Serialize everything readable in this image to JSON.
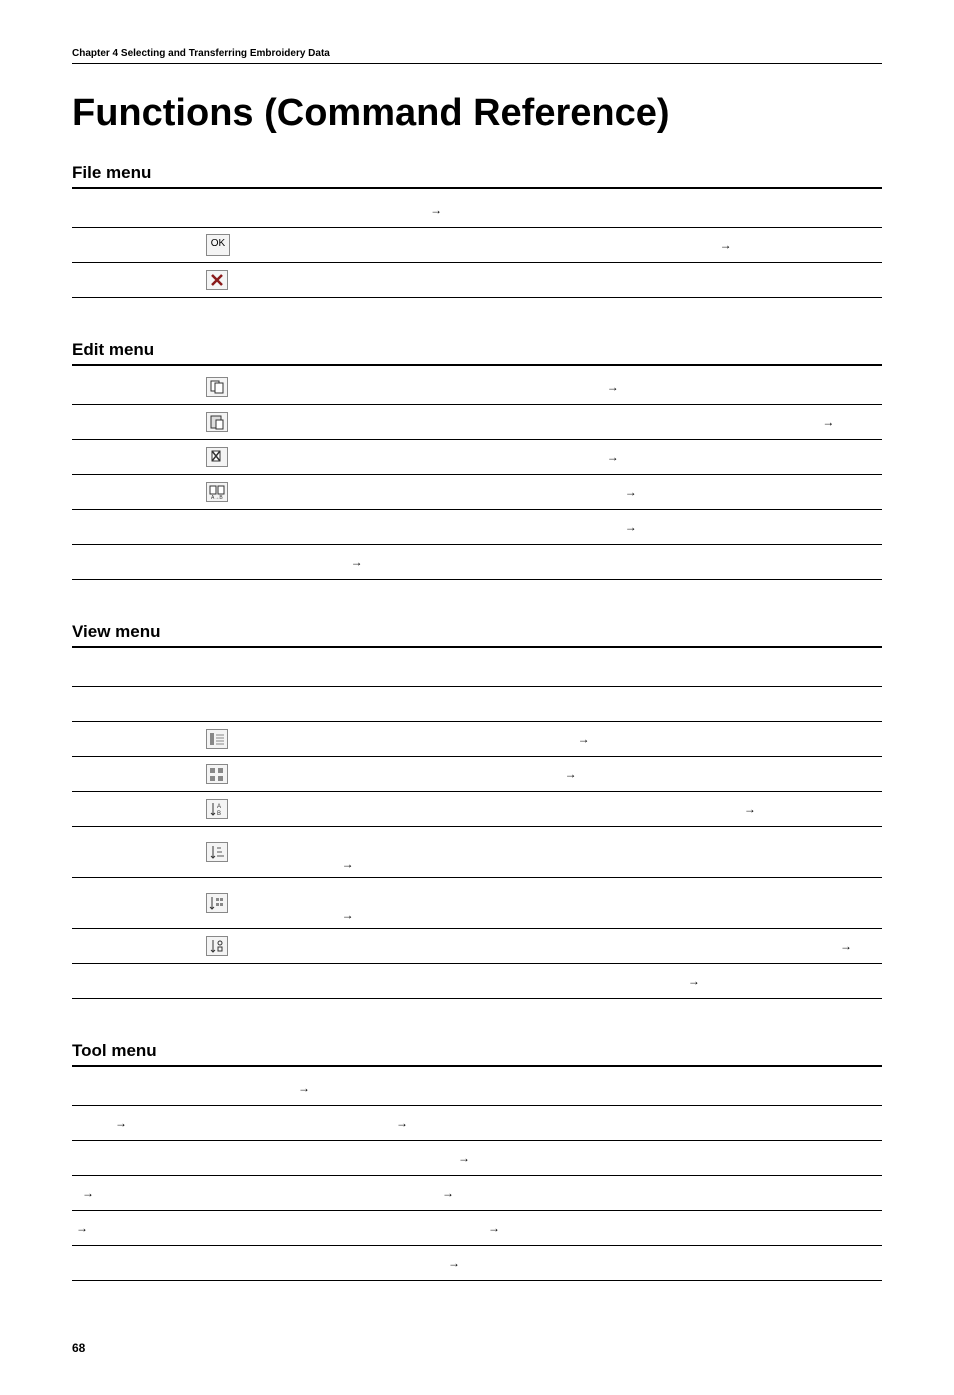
{
  "chapter": "Chapter 4  Selecting and Transferring Embroidery Data",
  "page_title": "Functions (Command Reference)",
  "page_number": "68",
  "arrow": "→",
  "menus": {
    "file": {
      "heading": "File menu",
      "rows": [
        {
          "icon": null,
          "arrows": 1
        },
        {
          "icon": "ok",
          "arrows": 1
        },
        {
          "icon": "close-x",
          "arrows": 0
        }
      ]
    },
    "edit": {
      "heading": "Edit menu",
      "rows": [
        {
          "icon": "copy",
          "arrows": 1
        },
        {
          "icon": "paste",
          "arrows": 1
        },
        {
          "icon": "delete",
          "arrows": 1
        },
        {
          "icon": "rename",
          "arrows": 1
        },
        {
          "icon": null,
          "arrows": 1
        },
        {
          "icon": null,
          "arrows": 1
        }
      ]
    },
    "view": {
      "heading": "View menu",
      "rows": [
        {
          "icon": null,
          "arrows": 0
        },
        {
          "icon": null,
          "arrows": 0
        },
        {
          "icon": "list-detail",
          "arrows": 1
        },
        {
          "icon": "thumb-grid",
          "arrows": 1
        },
        {
          "icon": "sort-name",
          "arrows": 1
        },
        {
          "icon": "sort-size-tall",
          "arrows": 1,
          "tall": true
        },
        {
          "icon": "sort-grid-tall",
          "arrows": 1,
          "tall": true
        },
        {
          "icon": "sort-type",
          "arrows": 1
        },
        {
          "icon": null,
          "arrows": 1
        }
      ]
    },
    "tool": {
      "heading": "Tool menu",
      "rows": [
        {
          "icon": null,
          "arrows": 1
        },
        {
          "icon": null,
          "arrows": 2,
          "early": true
        },
        {
          "icon": null,
          "arrows": 1
        },
        {
          "icon": null,
          "arrows": 2,
          "early2": true
        },
        {
          "icon": null,
          "arrows": 2,
          "early2": true
        },
        {
          "icon": null,
          "arrows": 1
        }
      ]
    }
  }
}
